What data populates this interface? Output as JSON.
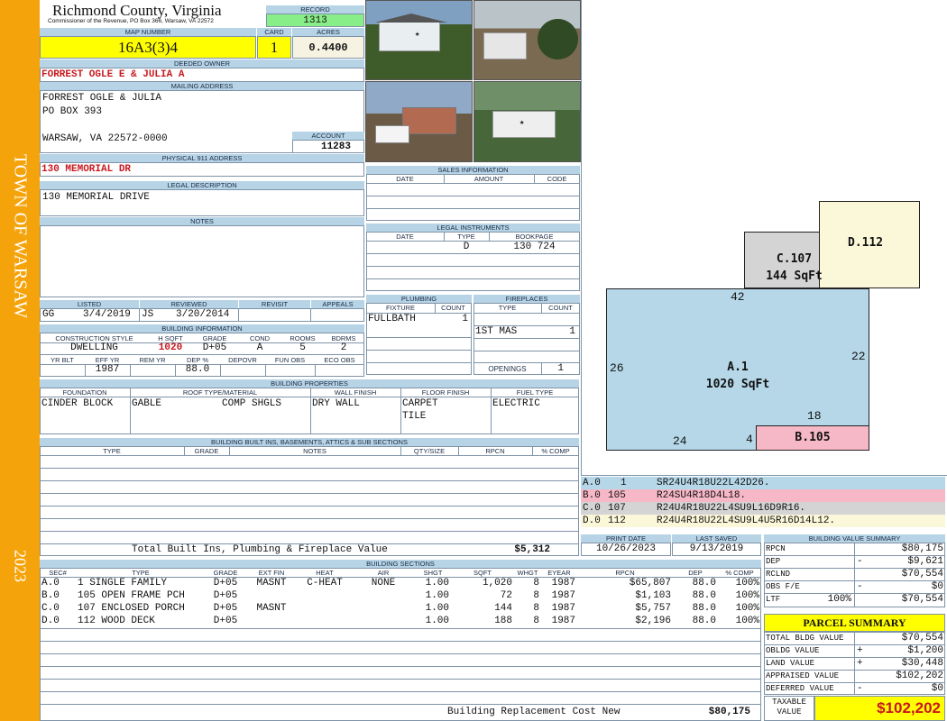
{
  "sidebar": {
    "town": "TOWN OF WARSAW",
    "year": "2023"
  },
  "header": {
    "county": "Richmond County, Virginia",
    "commissioner": "Commissioner of the Revenue, PO Box 366, Warsaw, VA 22572",
    "record_label": "RECORD",
    "record": "1313",
    "map_label": "MAP NUMBER",
    "map_number": "16A3(3)4",
    "card_label": "CARD",
    "card": "1",
    "acres_label": "ACRES",
    "acres": "0.4400"
  },
  "owner": {
    "label": "DEEDED OWNER",
    "name": "FORREST OGLE E & JULIA A",
    "mailing_label": "MAILING ADDRESS",
    "line1": "FORREST OGLE & JULIA",
    "line2": "PO BOX 393",
    "line3": "WARSAW, VA 22572-0000",
    "account_label": "ACCOUNT",
    "account": "11283"
  },
  "address": {
    "label": "PHYSICAL 911 ADDRESS",
    "value": "130 MEMORIAL DR"
  },
  "legal": {
    "label": "LEGAL DESCRIPTION",
    "value": "130 MEMORIAL DRIVE"
  },
  "notes": {
    "label": "NOTES"
  },
  "listed": {
    "listed_label": "LISTED",
    "reviewed_label": "REVIEWED",
    "revisit_label": "REVISIT",
    "appeals_label": "APPEALS",
    "listed_by": "GG",
    "listed_date": "3/4/2019",
    "reviewed_by": "JS",
    "reviewed_date": "3/20/2014"
  },
  "building_info": {
    "label": "BUILDING INFORMATION",
    "h1": [
      "CONSTRUCTION STYLE",
      "H SQFT",
      "GRADE",
      "COND",
      "ROOMS",
      "BDRMS"
    ],
    "style": "DWELLING",
    "hsqft": "1020",
    "grade": "D+05",
    "cond": "A",
    "rooms": "5",
    "bdrms": "2",
    "h2": [
      "YR BLT",
      "EFF YR",
      "REM YR",
      "DEP %",
      "DEPOVR",
      "FUN OBS",
      "ECO OBS"
    ],
    "yr_blt": "",
    "eff_yr": "1987",
    "rem_yr": "",
    "dep": "88.0"
  },
  "sales": {
    "label": "SALES INFORMATION",
    "cols": [
      "DATE",
      "AMOUNT",
      "CODE"
    ]
  },
  "legal_inst": {
    "label": "LEGAL INSTRUMENTS",
    "cols": [
      "DATE",
      "TYPE",
      "BOOKPAGE"
    ],
    "type": "D",
    "bookpage": "130 724"
  },
  "plumbing": {
    "label": "PLUMBING",
    "fixture_label": "FIXTURE",
    "count_label": "COUNT",
    "fixture": "FULLBATH",
    "count": "1"
  },
  "fireplaces": {
    "label": "FIREPLACES",
    "type_label": "TYPE",
    "count_label": "COUNT",
    "type": "1ST MAS",
    "count": "1",
    "openings_label": "OPENINGS",
    "openings": "1"
  },
  "properties": {
    "label": "BUILDING PROPERTIES",
    "cols": [
      "FOUNDATION",
      "ROOF TYPE/MATERIAL",
      "WALL FINISH",
      "FLOOR FINISH",
      "FUEL TYPE"
    ],
    "foundation": "CINDER BLOCK",
    "roof_type": "GABLE",
    "roof_material": "COMP SHGLS",
    "wall": "DRY WALL",
    "floor1": "CARPET",
    "floor2": "TILE",
    "fuel": "ELECTRIC"
  },
  "builtins": {
    "label": "BUILDING BUILT INS, BASEMENTS, ATTICS & SUB SECTIONS",
    "cols": [
      "TYPE",
      "GRADE",
      "NOTES",
      "QTY/SIZE",
      "RPCN",
      "% COMP"
    ],
    "total_label": "Total Built Ins, Plumbing & Fireplace Value",
    "total": "$5,312"
  },
  "dates": {
    "print_label": "PRINT DATE",
    "saved_label": "LAST SAVED",
    "print": "10/26/2023",
    "saved": "9/13/2019"
  },
  "sections": {
    "label": "BUILDING SECTIONS",
    "cols": [
      "SEC#",
      "TYPE",
      "GRADE",
      "EXT FIN",
      "HEAT",
      "AIR",
      "SHGT",
      "SQFT",
      "WHGT",
      "EYEAR",
      "RPCN",
      "DEP",
      "% COMP"
    ],
    "rows": [
      [
        "A.0",
        "1 SINGLE FAMILY",
        "D+05",
        "MASNT",
        "C-HEAT",
        "NONE",
        "1.00",
        "1,020",
        "8",
        "1987",
        "$65,807",
        "88.0",
        "100%"
      ],
      [
        "B.0",
        "105 OPEN FRAME PCH",
        "D+05",
        "",
        "",
        "",
        "1.00",
        "72",
        "8",
        "1987",
        "$1,103",
        "88.0",
        "100%"
      ],
      [
        "C.0",
        "107 ENCLOSED PORCH",
        "D+05",
        "MASNT",
        "",
        "",
        "1.00",
        "144",
        "8",
        "1987",
        "$5,757",
        "88.0",
        "100%"
      ],
      [
        "D.0",
        "112 WOOD DECK",
        "D+05",
        "",
        "",
        "",
        "1.00",
        "188",
        "8",
        "1987",
        "$2,196",
        "88.0",
        "100%"
      ]
    ],
    "replacement_label": "Building Replacement Cost New",
    "replacement": "$80,175"
  },
  "sketch": {
    "a_label": "A.1",
    "a_area": "1020 SqFt",
    "b_label": "B.105",
    "c_label": "C.107",
    "c_area": "144 SqFt",
    "d_label": "D.112",
    "dims": [
      "42",
      "26",
      "22",
      "18",
      "24",
      "4"
    ],
    "codes": [
      {
        "sec": "A.0",
        "num": "1",
        "code": "SR24U4R18U22L42D26.",
        "color": "#b5d7e8"
      },
      {
        "sec": "B.0",
        "num": "105",
        "code": "R24SU4R18D4L18.",
        "color": "#f6b7c6"
      },
      {
        "sec": "C.0",
        "num": "107",
        "code": "R24U4R18U22L4SU9L16D9R16.",
        "color": "#d4d4d4"
      },
      {
        "sec": "D.0",
        "num": "112",
        "code": "R24U4R18U22L4SU9L4U5R16D14L12.",
        "color": "#fbf7d9"
      }
    ]
  },
  "bvs": {
    "label": "BUILDING VALUE SUMMARY",
    "rpcn_label": "RPCN",
    "rpcn": "$80,175",
    "dep_label": "DEP",
    "dep": "$9,621",
    "rclnd_label": "RCLND",
    "rclnd": "$70,554",
    "obs_label": "OBS F/E",
    "obs": "$0",
    "ltf_label": "LTF",
    "ltf_pct": "100%",
    "ltf": "$70,554"
  },
  "parcel": {
    "label": "PARCEL SUMMARY",
    "bldg_label": "TOTAL BLDG VALUE",
    "bldg": "$70,554",
    "obldg_label": "OBLDG VALUE",
    "obldg": "$1,200",
    "land_label": "LAND VALUE",
    "land": "$30,448",
    "appraised_label": "APPRAISED VALUE",
    "appraised": "$102,202",
    "deferred_label": "DEFERRED VALUE",
    "deferred": "$0",
    "taxable_label1": "TAXABLE",
    "taxable_label2": "VALUE",
    "taxable": "$102,202"
  },
  "colors": {
    "sidebar": "#f5a30a",
    "header_band": "#b7d3e6",
    "highlight": "#ffff00",
    "record": "#88ee88",
    "accent_red": "#c8181e"
  }
}
